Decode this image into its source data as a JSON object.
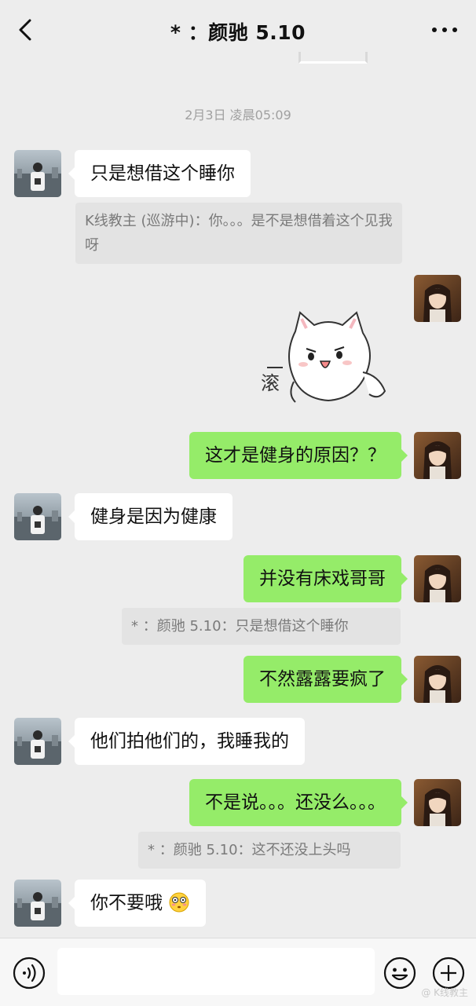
{
  "header": {
    "title": "* ：颜驰 5.10"
  },
  "timestamp": "2月3日 凌晨05:09",
  "messages": [
    {
      "text": "只是想借这个睡你"
    },
    {
      "quote": "K线教主 (巡游中)：你。。。是不是想借着这个见我呀"
    },
    {
      "sticker_text": "滚"
    },
    {
      "text": "这才是健身的原因？？"
    },
    {
      "text": "健身是因为健康"
    },
    {
      "text": "并没有床戏哥哥"
    },
    {
      "quote": "* ：颜驰 5.10：只是想借这个睡你"
    },
    {
      "text": "不然露露要疯了"
    },
    {
      "text": "他们拍他们的，我睡我的"
    },
    {
      "text": "不是说。。。还没么。。。"
    },
    {
      "quote": "* ：颜驰 5.10：这不还没上头吗"
    },
    {
      "text": "你不要哦"
    }
  ],
  "watermark": "@ K线教主",
  "icons": [
    "back-icon",
    "more-icon",
    "voice-icon",
    "emoji-icon",
    "plus-icon",
    "flushed-emoji-icon"
  ],
  "colors": {
    "background": "#ededed",
    "outgoing_bubble": "#95ec69",
    "incoming_bubble": "#ffffff"
  }
}
